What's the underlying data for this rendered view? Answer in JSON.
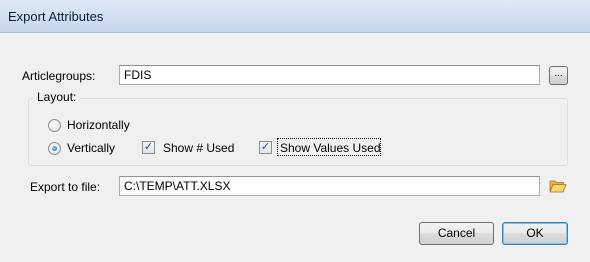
{
  "window": {
    "title": "Export Attributes"
  },
  "articlegroups": {
    "label": "Articlegroups:",
    "value": "FDIS",
    "browse_label": "..."
  },
  "layout": {
    "group_label": "Layout:",
    "horizontally_label": "Horizontally",
    "vertically_label": "Vertically",
    "selected": "Vertically",
    "show_used_label": "Show # Used",
    "show_used_checked": true,
    "show_values_used_label": "Show Values Used",
    "show_values_used_checked": true
  },
  "export": {
    "label": "Export to file:",
    "value": "C:\\TEMP\\ATT.XLSX",
    "icon": "folder-open-icon"
  },
  "buttons": {
    "cancel_label": "Cancel",
    "ok_label": "OK"
  },
  "colors": {
    "titlebar": "#c6d7ec",
    "dialog_bg": "#f0f0f0",
    "default_button_border": "#3c7fb1"
  }
}
